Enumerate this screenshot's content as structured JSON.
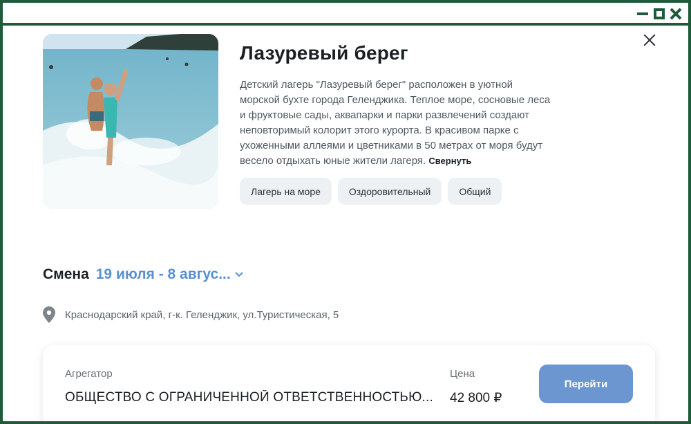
{
  "camp": {
    "title": "Лазуревый берег",
    "description": "Детский лагерь \"Лазуревый берег\" расположен в уютной морской бухте города Геленджика. Теплое море, сосновые леса и фруктовые сады, аквапарки и парки развлечений создают неповторимый колорит этого курорта. В красивом парке с ухоженными аллеями и цветниками в 50 метрах от моря будут весело отдыхать юные жители лагеря.",
    "collapse_label": "Свернуть",
    "tags": [
      "Лагерь на море",
      "Оздоровительный",
      "Общий"
    ],
    "photo_icon": "beach-children-photo"
  },
  "session": {
    "label": "Смена",
    "value": "19 июля - 8 авгус..."
  },
  "address": {
    "text": "Краснодарский край, г-к. Геленджик, ул.Туристическая, 5"
  },
  "offer": {
    "aggregator_label": "Агрегатор",
    "aggregator_value": "ОБЩЕСТВО С ОГРАНИЧЕННОЙ ОТВЕТСТВЕННОСТЬЮ...",
    "price_label": "Цена",
    "price_value": "42 800 ₽",
    "go_label": "Перейти"
  },
  "colors": {
    "frame": "#1f5a3a",
    "accent": "#5a8fd0",
    "button": "#6b96cf",
    "tag_bg": "#eef1f3"
  }
}
